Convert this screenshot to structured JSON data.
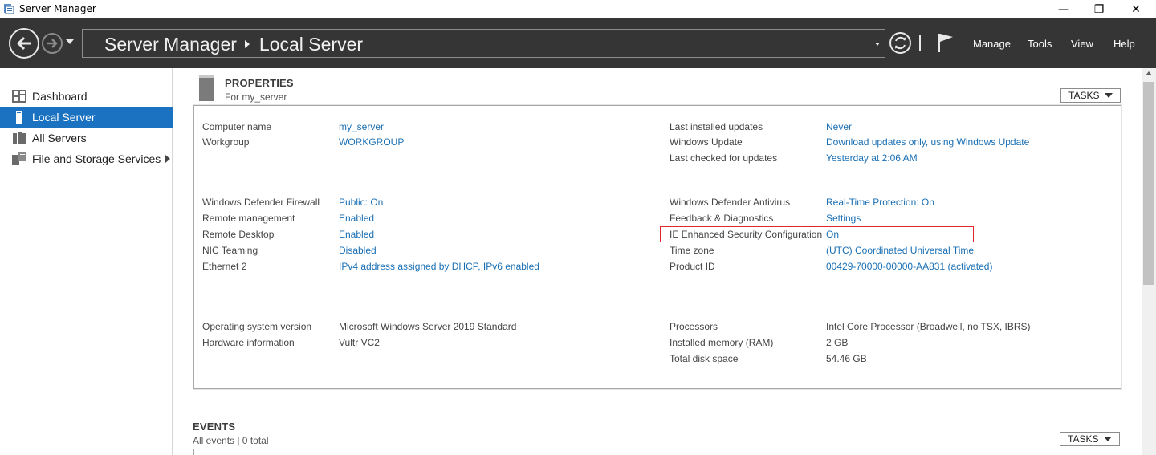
{
  "window": {
    "title": "Server Manager",
    "controls": {
      "minimize": "—",
      "maximize": "❐",
      "close": "✕"
    }
  },
  "header": {
    "breadcrumb_root": "Server Manager",
    "breadcrumb_current": "Local Server",
    "menu": [
      "Manage",
      "Tools",
      "View",
      "Help"
    ]
  },
  "sidebar": {
    "items": [
      {
        "label": "Dashboard",
        "icon": "dashboard-icon",
        "active": false
      },
      {
        "label": "Local Server",
        "icon": "server-icon",
        "active": true
      },
      {
        "label": "All Servers",
        "icon": "servers-icon",
        "active": false
      },
      {
        "label": "File and Storage Services",
        "icon": "storage-icon",
        "active": false,
        "has_submenu": true
      }
    ]
  },
  "properties": {
    "title": "PROPERTIES",
    "subtitle": "For my_server",
    "tasks_label": "TASKS",
    "left": [
      {
        "label": "Computer name",
        "value": "my_server",
        "link": true
      },
      {
        "label": "Workgroup",
        "value": "WORKGROUP",
        "link": true
      },
      {
        "label": "Windows Defender Firewall",
        "value": "Public: On",
        "link": true
      },
      {
        "label": "Remote management",
        "value": "Enabled",
        "link": true
      },
      {
        "label": "Remote Desktop",
        "value": "Enabled",
        "link": true
      },
      {
        "label": "NIC Teaming",
        "value": "Disabled",
        "link": true
      },
      {
        "label": "Ethernet 2",
        "value": "IPv4 address assigned by DHCP, IPv6 enabled",
        "link": true
      },
      {
        "label": "Operating system version",
        "value": "Microsoft Windows Server 2019 Standard",
        "link": false
      },
      {
        "label": "Hardware information",
        "value": "Vultr VC2",
        "link": false
      }
    ],
    "right": [
      {
        "label": "Last installed updates",
        "value": "Never",
        "link": true
      },
      {
        "label": "Windows Update",
        "value": "Download updates only, using Windows Update",
        "link": true
      },
      {
        "label": "Last checked for updates",
        "value": "Yesterday at 2:06 AM",
        "link": true
      },
      {
        "label": "Windows Defender Antivirus",
        "value": "Real-Time Protection: On",
        "link": true
      },
      {
        "label": "Feedback & Diagnostics",
        "value": "Settings",
        "link": true
      },
      {
        "label": "IE Enhanced Security Configuration",
        "value": "On",
        "link": true,
        "highlighted": true
      },
      {
        "label": "Time zone",
        "value": "(UTC) Coordinated Universal Time",
        "link": true
      },
      {
        "label": "Product ID",
        "value": "00429-70000-00000-AA831 (activated)",
        "link": true
      },
      {
        "label": "Processors",
        "value": "Intel Core Processor (Broadwell, no TSX, IBRS)",
        "link": false
      },
      {
        "label": "Installed memory (RAM)",
        "value": "2 GB",
        "link": false
      },
      {
        "label": "Total disk space",
        "value": "54.46 GB",
        "link": false
      }
    ],
    "highlight_color": "#e0262e"
  },
  "events": {
    "title": "EVENTS",
    "subtitle": "All events | 0 total",
    "tasks_label": "TASKS"
  },
  "colors": {
    "header_bg": "#353535",
    "active_item": "#1b72c1",
    "link": "#1a6fb3"
  }
}
